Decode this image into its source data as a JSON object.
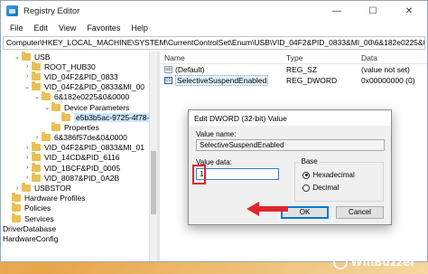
{
  "window": {
    "title": "Registry Editor",
    "controls": [
      "—",
      "☐",
      "✕"
    ]
  },
  "menu": [
    "File",
    "Edit",
    "View",
    "Favorites",
    "Help"
  ],
  "address": "Computer\\HKEY_LOCAL_MACHINE\\SYSTEM\\CurrentControlSet\\Enum\\USB\\VID_04F2&PID_0833&MI_00\\6&182e0225&0&0000",
  "tree": [
    {
      "label": "USB",
      "indent": 1,
      "chev": "⌄"
    },
    {
      "label": "ROOT_HUB30",
      "indent": 2,
      "chev": "›"
    },
    {
      "label": "VID_04F2&PID_0833",
      "indent": 2,
      "chev": "›"
    },
    {
      "label": "VID_04F2&PID_0833&MI_00",
      "indent": 2,
      "chev": "⌄"
    },
    {
      "label": "6&182e0225&0&0000",
      "indent": 3,
      "chev": "⌄"
    },
    {
      "label": "Device Parameters",
      "indent": 4,
      "chev": "⌄"
    },
    {
      "label": "e5b3b5ac-9725-4f78-9",
      "indent": 5,
      "chev": "",
      "selected": true
    },
    {
      "label": "Properties",
      "indent": 4,
      "chev": ""
    },
    {
      "label": "6&386f57de&0&0000",
      "indent": 3,
      "chev": "›"
    },
    {
      "label": "VID_04F2&PID_0833&MI_01",
      "indent": 2,
      "chev": "›"
    },
    {
      "label": "VID_14CD&PID_6116",
      "indent": 2,
      "chev": "›"
    },
    {
      "label": "VID_1BCF&PID_0005",
      "indent": 2,
      "chev": "›"
    },
    {
      "label": "VID_8087&PID_0A2B",
      "indent": 2,
      "chev": "›"
    },
    {
      "label": "USBSTOR",
      "indent": 1,
      "chev": "›"
    },
    {
      "label": "Hardware Profiles",
      "indent": 0,
      "chev": ""
    },
    {
      "label": "Policies",
      "indent": 0,
      "chev": ""
    },
    {
      "label": "Services",
      "indent": 0,
      "chev": ""
    },
    {
      "label": "DriverDatabase",
      "indent": -1,
      "chev": "",
      "nofolder": true
    },
    {
      "label": "HardwareConfig",
      "indent": -1,
      "chev": "",
      "nofolder": true
    }
  ],
  "values": {
    "headers": {
      "name": "Name",
      "type": "Type",
      "data": "Data"
    },
    "rows": [
      {
        "icon": "ab",
        "name": "(Default)",
        "type": "REG_SZ",
        "data": "(value not set)"
      },
      {
        "icon": "01",
        "name": "SelectiveSuspendEnabled",
        "type": "REG_DWORD",
        "data": "0x00000000 (0)",
        "selected": true
      }
    ]
  },
  "dialog": {
    "title": "Edit DWORD (32-bit) Value",
    "value_name_label": "Value name:",
    "value_name": "SelectiveSuspendEnabled",
    "value_data_label": "Value data:",
    "value_data": "1",
    "base_label": "Base",
    "hex_label": "Hexadecimal",
    "dec_label": "Decimal",
    "ok": "OK",
    "cancel": "Cancel"
  },
  "watermark": "WinBuzzer",
  "colors": {
    "highlight": "#e0262a",
    "accent": "#0078d7"
  }
}
